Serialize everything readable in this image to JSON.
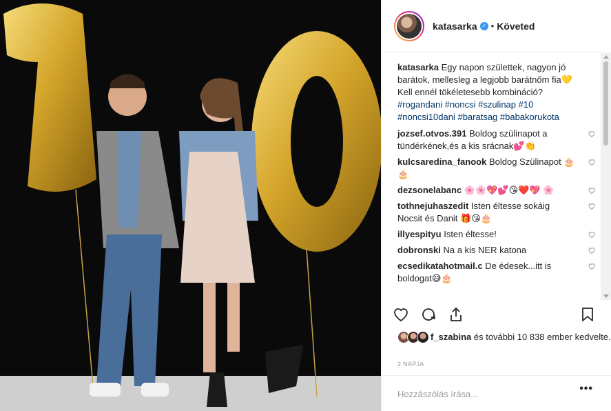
{
  "post": {
    "username": "katasarka",
    "follow_separator": "•",
    "follow_status": "Követed",
    "caption_user": "katasarka",
    "caption_text": "Egy napon születtek, nagyon jó barátok, mellesleg a legjobb barátnőm fia💛 Kell ennél tökéletesebb kombináció?",
    "caption_tags": "#rogandani #noncsi #szulinap #10 #noncsi10dani #baratsag #babakorukota"
  },
  "comments": [
    {
      "user": "jozsef.otvos.391",
      "text": "Boldog szülinapot a tündérkének,és a kis srácnak💕👏"
    },
    {
      "user": "kulcsaredina_fanook",
      "text": "Boldog Szülinapot 🎂🎂"
    },
    {
      "user": "dezsonelabanc",
      "text": "🌸🌸💖💕😘❤️💖 🌸"
    },
    {
      "user": "tothnejuhaszedit",
      "text": "Isten éltesse sokáig Nocsit és Danit 🎁😘🎂"
    },
    {
      "user": "illyespityu",
      "text": "Isten éltesse!"
    },
    {
      "user": "dobronski",
      "text": "Na a kis NER katona"
    },
    {
      "user": "ecsedikatahotmail.c",
      "text": "De édesek...itt is boldogat😅🎂"
    }
  ],
  "likes": {
    "user": "f_szabina",
    "text": " és további 10 838 ember kedvelte."
  },
  "time_ago": "2 NAPJA",
  "add_comment_placeholder": "Hozzászólás írása...",
  "more_label": "•••",
  "colors": {
    "link": "#003569",
    "verified": "#3897f0",
    "balloon": "#d4a52a"
  }
}
